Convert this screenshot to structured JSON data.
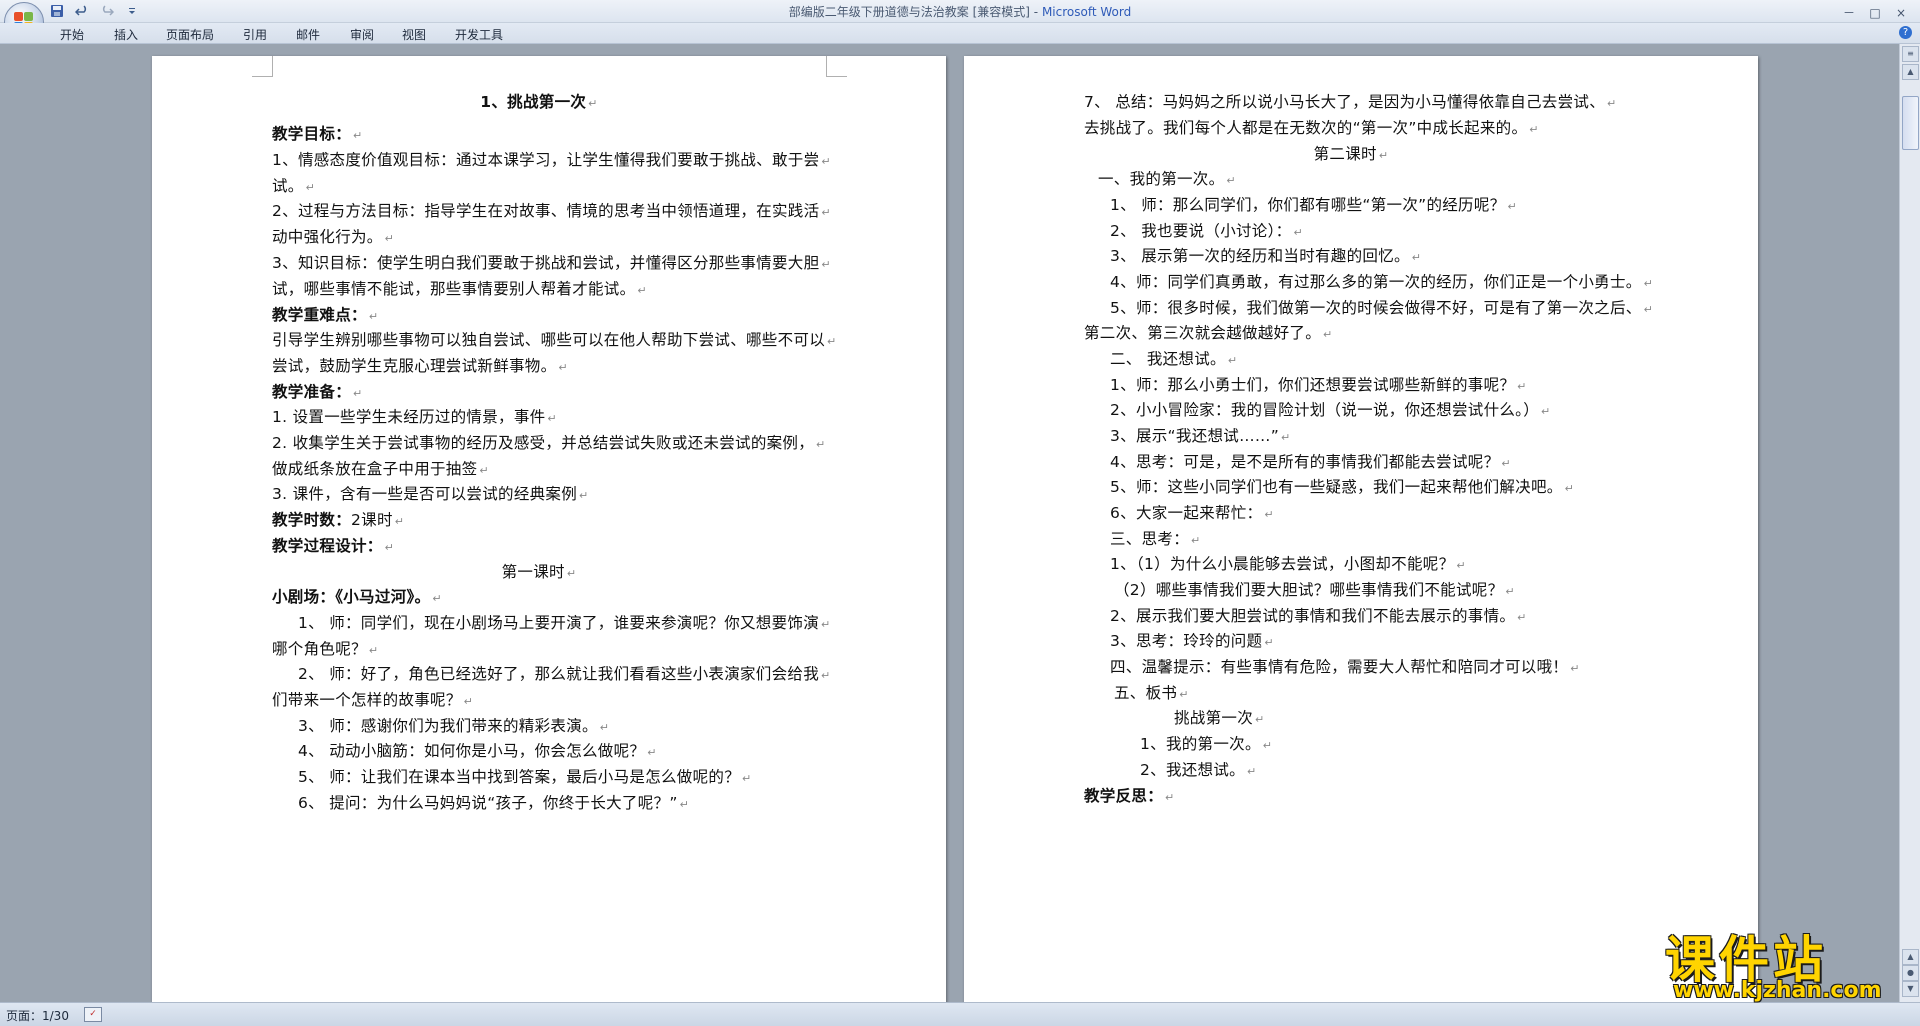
{
  "window": {
    "title_doc": "部编版二年级下册道德与法治教案 [兼容模式]",
    "title_sep": " - ",
    "title_app": "Microsoft Word",
    "controls": [
      "－",
      "□",
      "×"
    ]
  },
  "quick_access": {
    "icons": [
      "save-icon",
      "undo-icon",
      "redo-icon",
      "customize-icon"
    ]
  },
  "menu": {
    "items": [
      "开始",
      "插入",
      "页面布局",
      "引用",
      "邮件",
      "审阅",
      "视图",
      "开发工具"
    ],
    "help": "?"
  },
  "left_page": {
    "lines": [
      {
        "text": "1、挑战第一次",
        "bold": true
      },
      {
        "text": "教学目标：",
        "bold": true
      },
      {
        "text": "1、情感态度价值观目标：通过本课学习，让学生懂得我们要敢于挑战、敢于尝"
      },
      {
        "text": "试。"
      },
      {
        "text": "2、过程与方法目标：指导学生在对故事、情境的思考当中领悟道理，在实践活"
      },
      {
        "text": "动中强化行为。"
      },
      {
        "text": "3、知识目标：使学生明白我们要敢于挑战和尝试，并懂得区分那些事情要大胆"
      },
      {
        "text": "试，哪些事情不能试，那些事情要别人帮着才能试。"
      },
      {
        "text": "教学重难点：",
        "bold": true
      },
      {
        "text": "引导学生辨别哪些事物可以独自尝试、哪些可以在他人帮助下尝试、哪些不可以"
      },
      {
        "text": "尝试，鼓励学生克服心理尝试新鲜事物。"
      },
      {
        "text": "教学准备：",
        "bold": true
      },
      {
        "text": "1. 设置一些学生未经历过的情景，事件"
      },
      {
        "text": "2. 收集学生关于尝试事物的经历及感受，并总结尝试失败或还未尝试的案例，"
      },
      {
        "text": "做成纸条放在盒子中用于抽签"
      },
      {
        "text": "3. 课件，含有一些是否可以尝试的经典案例"
      },
      {
        "text": "教学时数：",
        "bold": true,
        "extra": "2课时"
      },
      {
        "text": "教学过程设计：",
        "bold": true
      },
      {
        "text": "第一课时"
      },
      {
        "text": "小剧场：《小马过河》。",
        "bold": true
      },
      {
        "text": "1、 师：同学们，现在小剧场马上要开演了，谁要来参演呢？你又想要饰演"
      },
      {
        "text": "哪个角色呢？"
      },
      {
        "text": "2、 师：好了，角色已经选好了，那么就让我们看看这些小表演家们会给我"
      },
      {
        "text": "们带来一个怎样的故事呢？"
      },
      {
        "text": "3、 师：感谢你们为我们带来的精彩表演。"
      },
      {
        "text": "4、 动动小脑筋：如何你是小马，你会怎么做呢？"
      },
      {
        "text": "5、 师：让我们在课本当中找到答案，最后小马是怎么做呢的？"
      },
      {
        "text": "6、 提问：为什么马妈妈说“孩子，你终于长大了呢？”"
      }
    ]
  },
  "right_page": {
    "lines": [
      {
        "text": "7、 总结：马妈妈之所以说小马长大了，是因为小马懂得依靠自己去尝试、"
      },
      {
        "text": "去挑战了。我们每个人都是在无数次的“第一次”中成长起来的。"
      },
      {
        "text": "第二课时"
      },
      {
        "text": "一、我的第一次。"
      },
      {
        "text": "1、 师：那么同学们，你们都有哪些“第一次”的经历呢？"
      },
      {
        "text": "2、 我也要说（小讨论）："
      },
      {
        "text": "3、 展示第一次的经历和当时有趣的回忆。"
      },
      {
        "text": "4、师：同学们真勇敢，有过那么多的第一次的经历，你们正是一个小勇士。"
      },
      {
        "text": "5、师：很多时候，我们做第一次的时候会做得不好，可是有了第一次之后、"
      },
      {
        "text": "第二次、第三次就会越做越好了。"
      },
      {
        "text": "二、 我还想试。"
      },
      {
        "text": "1、师：那么小勇士们，你们还想要尝试哪些新鲜的事呢？"
      },
      {
        "text": "2、小小冒险家：我的冒险计划（说一说，你还想尝试什么。）"
      },
      {
        "text": "3、展示“我还想试……”"
      },
      {
        "text": "4、思考：可是，是不是所有的事情我们都能去尝试呢？"
      },
      {
        "text": "5、师：这些小同学们也有一些疑惑，我们一起来帮他们解决吧。"
      },
      {
        "text": "6、大家一起来帮忙："
      },
      {
        "text": "三、思考："
      },
      {
        "text": "1、（1）为什么小晨能够去尝试，小图却不能呢？"
      },
      {
        "text": "（2）哪些事情我们要大胆试？哪些事情我们不能试呢？"
      },
      {
        "text": "2、展示我们要大胆尝试的事情和我们不能去展示的事情。"
      },
      {
        "text": "3、思考：玲玲的问题"
      },
      {
        "text": "四、温馨提示：有些事情有危险，需要大人帮忙和陪同才可以哦！"
      },
      {
        "text": "五、板书"
      },
      {
        "text": "挑战第一次"
      },
      {
        "text": "1、我的第一次。"
      },
      {
        "text": "2、我还想试。"
      },
      {
        "text": "教学反思：",
        "bold": true
      }
    ]
  },
  "status": {
    "page": "页面：1/30"
  },
  "watermark": {
    "title": "课件站",
    "url": "www.kjzhan.com"
  }
}
